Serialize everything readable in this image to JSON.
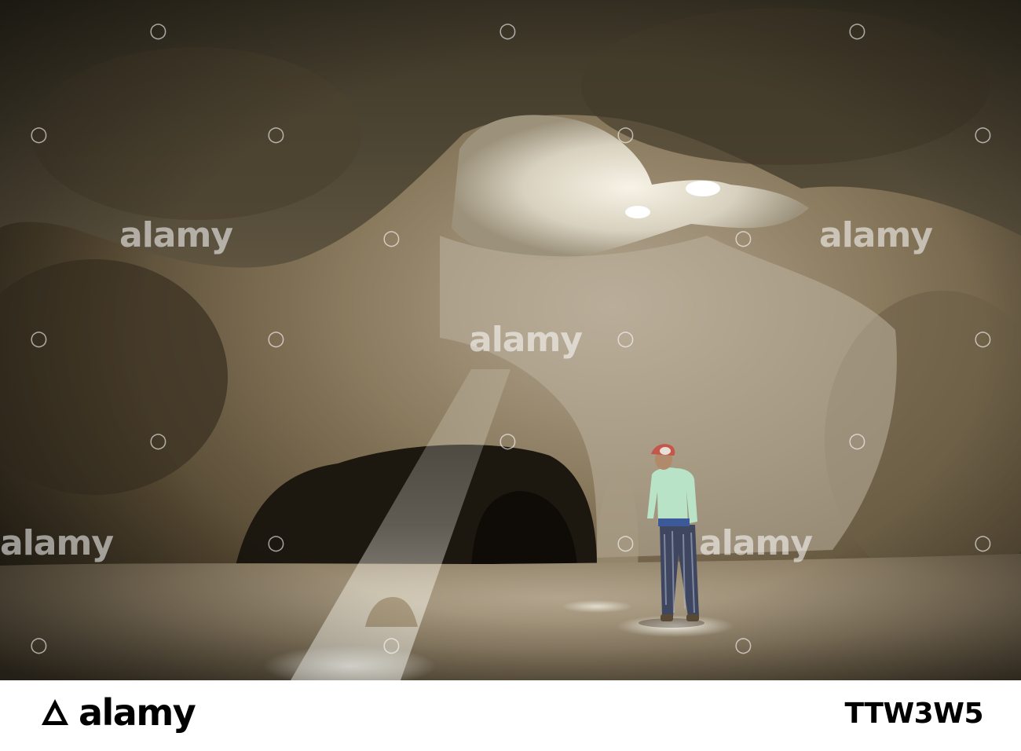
{
  "photo": {
    "subject": "cave-interior-with-light-beam",
    "colors": {
      "rock_dark": "#2a2418",
      "rock_mid": "#6b5d44",
      "rock_light": "#b8ad98",
      "floor": "#8f8068",
      "light": "#fffdf2",
      "shirt": "#b9e3c6",
      "cap": "#c4564a"
    }
  },
  "watermark": {
    "brand": "alamy",
    "logo_icon": "alamy-logo-icon"
  },
  "footer": {
    "brand": "alamy",
    "image_id": "TTW3W5"
  }
}
